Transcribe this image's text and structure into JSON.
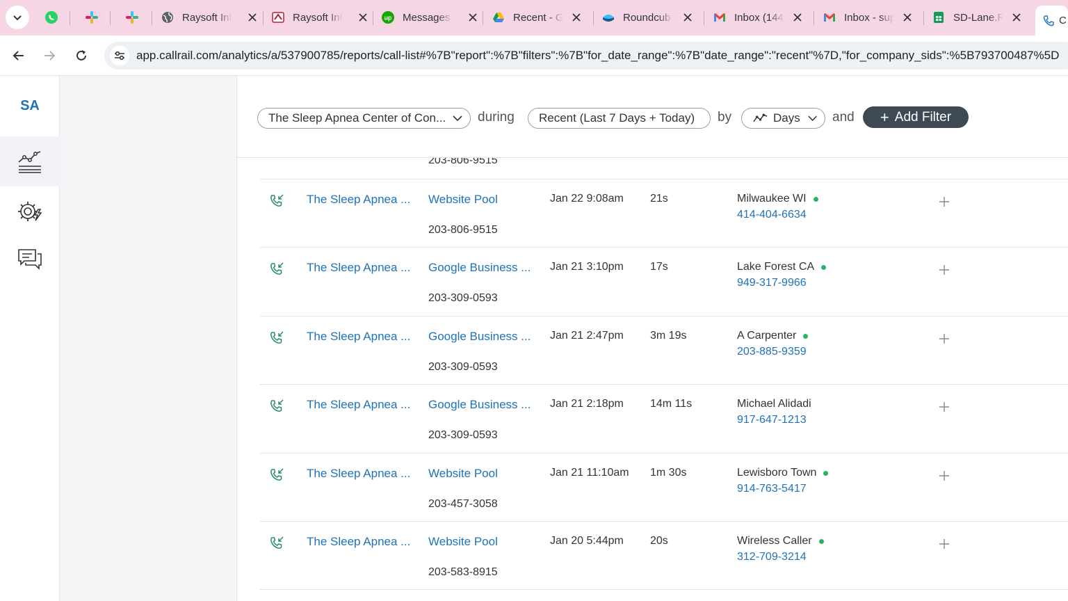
{
  "browser": {
    "tabs": [
      {
        "label": "Raysoft Inf",
        "icon": "globe-icon"
      },
      {
        "label": "Raysoft Inf",
        "icon": "raysoft-icon"
      },
      {
        "label": "Messages",
        "icon": "upwork-icon"
      },
      {
        "label": "Recent - G",
        "icon": "google-drive-icon"
      },
      {
        "label": "Roundcub",
        "icon": "roundcube-icon"
      },
      {
        "label": "Inbox (144",
        "icon": "gmail-icon"
      },
      {
        "label": "Inbox - sup",
        "icon": "gmail-icon"
      },
      {
        "label": "SD-Lane.R",
        "icon": "google-sheets-icon"
      },
      {
        "label": "C",
        "icon": "callrail-icon"
      }
    ],
    "url": "app.callrail.com/analytics/a/537900785/reports/call-list#%7B\"report\":%7B\"filters\":%7B\"for_date_range\":%7B\"date_range\":\"recent\"%7D,\"for_company_sids\":%5B793700487%5D"
  },
  "rail": {
    "account_initials": "SA"
  },
  "filters": {
    "company": "The Sleep Apnea Center of Con...",
    "during_label": "during",
    "date_range": "Recent (Last 7 Days + Today)",
    "by_label": "by",
    "interval": "Days",
    "and_label": "and",
    "add_filter": "Add Filter"
  },
  "previous_tracking_number": "203-806-9515",
  "calls": [
    {
      "company": "The Sleep Apnea ...",
      "source": "Website Pool",
      "tracking": "203-806-9515",
      "date": "Jan 22 9:08am",
      "duration": "21s",
      "caller": "Milwaukee WI",
      "caller_phone": "414-404-6634",
      "new_caller": true
    },
    {
      "company": "The Sleep Apnea ...",
      "source": "Google Business ...",
      "tracking": "203-309-0593",
      "date": "Jan 21 3:10pm",
      "duration": "17s",
      "caller": "Lake Forest CA",
      "caller_phone": "949-317-9966",
      "new_caller": true
    },
    {
      "company": "The Sleep Apnea ...",
      "source": "Google Business ...",
      "tracking": "203-309-0593",
      "date": "Jan 21 2:47pm",
      "duration": "3m 19s",
      "caller": "A Carpenter",
      "caller_phone": "203-885-9359",
      "new_caller": true
    },
    {
      "company": "The Sleep Apnea ...",
      "source": "Google Business ...",
      "tracking": "203-309-0593",
      "date": "Jan 21 2:18pm",
      "duration": "14m 11s",
      "caller": "Michael Alidadi",
      "caller_phone": "917-647-1213",
      "new_caller": false
    },
    {
      "company": "The Sleep Apnea ...",
      "source": "Website Pool",
      "tracking": "203-457-3058",
      "date": "Jan 21 11:10am",
      "duration": "1m 30s",
      "caller": "Lewisboro Town",
      "caller_phone": "914-763-5417",
      "new_caller": true
    },
    {
      "company": "The Sleep Apnea ...",
      "source": "Website Pool",
      "tracking": "203-583-8915",
      "date": "Jan 20 5:44pm",
      "duration": "20s",
      "caller": "Wireless Caller",
      "caller_phone": "312-709-3214",
      "new_caller": true
    }
  ],
  "colors": {
    "link": "#1f72b8",
    "new_caller_dot": "#2bb361",
    "tabstrip": "#f6d6e4",
    "add_filter_bg": "#3d4a56"
  }
}
